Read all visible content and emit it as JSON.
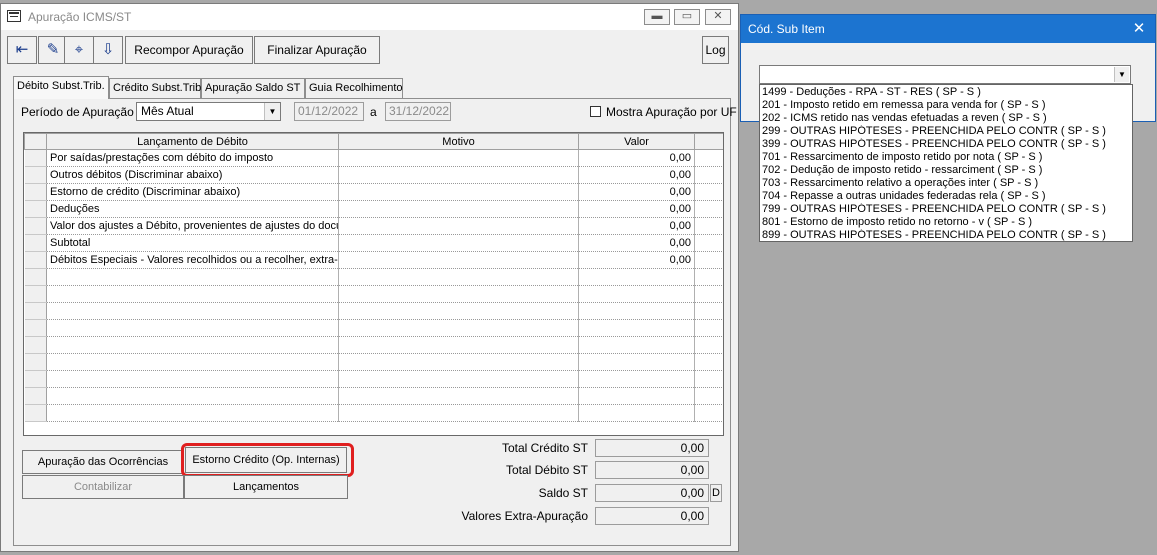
{
  "window": {
    "title": "Apuração ICMS/ST",
    "controls": {
      "minimize": "▬",
      "restore": "▭",
      "close": "✕"
    }
  },
  "toolbar": {
    "icons": [
      "exit-icon",
      "edit-icon",
      "binoculars-icon",
      "export-icon"
    ],
    "recompor_label": "Recompor Apuração",
    "finalizar_label": "Finalizar Apuração",
    "log_label": "Log"
  },
  "tabs": [
    {
      "label": "Débito Subst.Trib.",
      "active": true
    },
    {
      "label": "Crédito Subst.Trib.",
      "active": false
    },
    {
      "label": "Apuração Saldo ST",
      "active": false
    },
    {
      "label": "Guia Recolhimento",
      "active": false
    }
  ],
  "period": {
    "label": "Período de Apuração",
    "selected": "Mês Atual",
    "date_from": "01/12/2022",
    "separator": "a",
    "date_to": "31/12/2022",
    "checkbox_label": "Mostra Apuração por UF"
  },
  "grid": {
    "columns": [
      "Lançamento de Débito",
      "Motivo",
      "Valor"
    ],
    "rows": [
      {
        "lancamento": "Por saídas/prestações com débito do imposto",
        "motivo": "",
        "valor": "0,00"
      },
      {
        "lancamento": "Outros débitos (Discriminar abaixo)",
        "motivo": "",
        "valor": "0,00"
      },
      {
        "lancamento": "Estorno de crédito (Discriminar abaixo)",
        "motivo": "",
        "valor": "0,00"
      },
      {
        "lancamento": "Deduções",
        "motivo": "",
        "valor": "0,00"
      },
      {
        "lancamento": "Valor dos ajustes a Débito, provenientes de ajustes do documento",
        "motivo": "",
        "valor": "0,00"
      },
      {
        "lancamento": "Subtotal",
        "motivo": "",
        "valor": "0,00"
      },
      {
        "lancamento": "Débitos Especiais - Valores recolhidos ou a recolher, extra-apuração",
        "motivo": "",
        "valor": "0,00"
      }
    ]
  },
  "buttons": {
    "ocorrencias": "Apuração das Ocorrências",
    "estorno": "Estorno Crédito (Op. Internas)",
    "contabilizar": "Contabilizar",
    "lancamentos": "Lançamentos"
  },
  "totals": {
    "credito_label": "Total Crédito ST",
    "credito_value": "0,00",
    "debito_label": "Total Débito ST",
    "debito_value": "0,00",
    "saldo_label": "Saldo ST",
    "saldo_value": "0,00",
    "saldo_flag": "D",
    "extra_label": "Valores Extra-Apuração",
    "extra_value": "0,00"
  },
  "dialog": {
    "title": "Cód. Sub Item",
    "close": "✕",
    "selected": "",
    "options": [
      "1499 - Deduções - RPA - ST - RES ( SP - S )",
      "201 - Imposto retido em remessa para venda for ( SP - S )",
      "202 - ICMS retido nas vendas efetuadas a reven ( SP - S )",
      "299 - OUTRAS HIPÓTESES - PREENCHIDA PELO CONTR ( SP - S )",
      "399 - OUTRAS HIPÓTESES - PREENCHIDA PELO CONTR ( SP - S )",
      "701 - Ressarcimento de imposto retido por nota ( SP - S )",
      "702 - Dedução de imposto retido - ressarciment ( SP - S )",
      "703 - Ressarcimento relativo a operações inter ( SP - S )",
      "704 - Repasse a outras unidades federadas rela ( SP - S )",
      "799 - OUTRAS HIPÓTESES - PREENCHIDA PELO CONTR ( SP - S )",
      "801 - Estorno de imposto retido no retorno - v ( SP - S )",
      "899 - OUTRAS HIPÓTESES - PREENCHIDA PELO CONTR ( SP - S )"
    ]
  },
  "colors": {
    "highlight": "#e01f1f",
    "dialog_title": "#1c74d0",
    "desktop": "#a8a8a8"
  }
}
